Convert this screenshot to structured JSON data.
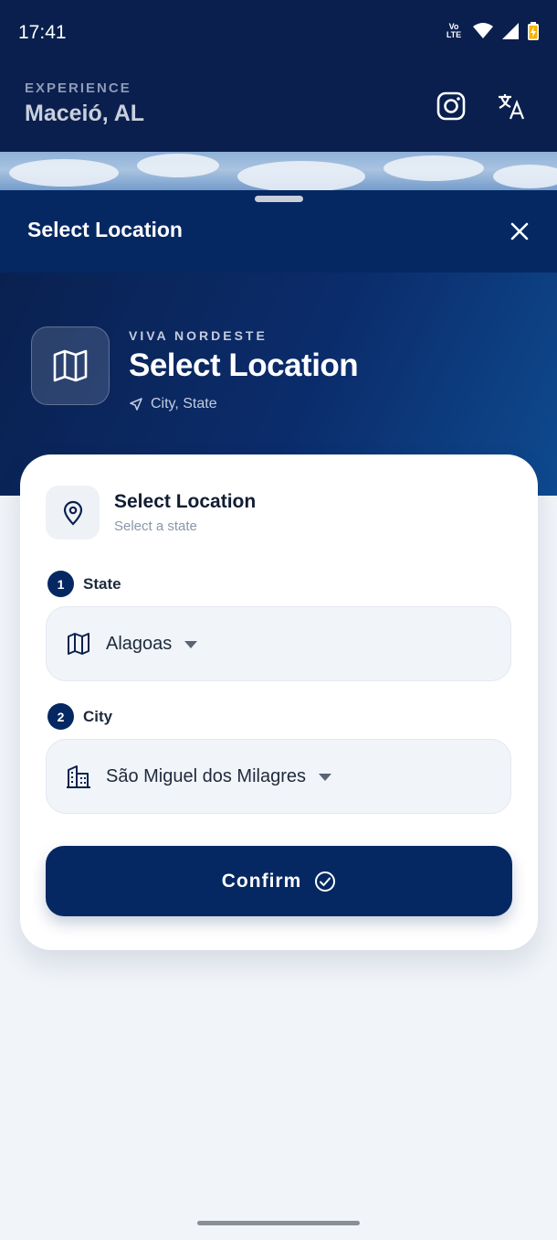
{
  "status_bar": {
    "time": "17:41",
    "network_badge": "Vo LTE",
    "icons": [
      "volte-icon",
      "wifi-icon",
      "signal-icon",
      "battery-charging-icon"
    ]
  },
  "header": {
    "label": "EXPERIENCE",
    "city": "Maceió, AL",
    "icons": [
      "instagram-icon",
      "translate-icon"
    ]
  },
  "sheet": {
    "title": "Select Location",
    "hero": {
      "kicker": "VIVA NORDESTE",
      "title": "Select Location",
      "subtitle": "City, State"
    },
    "card": {
      "title": "Select Location",
      "subtitle": "Select a state",
      "steps": [
        {
          "number": "1",
          "label": "State",
          "value": "Alagoas",
          "icon": "map-icon"
        },
        {
          "number": "2",
          "label": "City",
          "value": "São Miguel dos Milagres",
          "icon": "buildings-icon"
        }
      ],
      "confirm_label": "Confirm"
    }
  },
  "colors": {
    "navy": "#052863",
    "header_bg": "#0a1f4d",
    "card_bg": "#ffffff",
    "page_bg": "#f1f4f8"
  }
}
